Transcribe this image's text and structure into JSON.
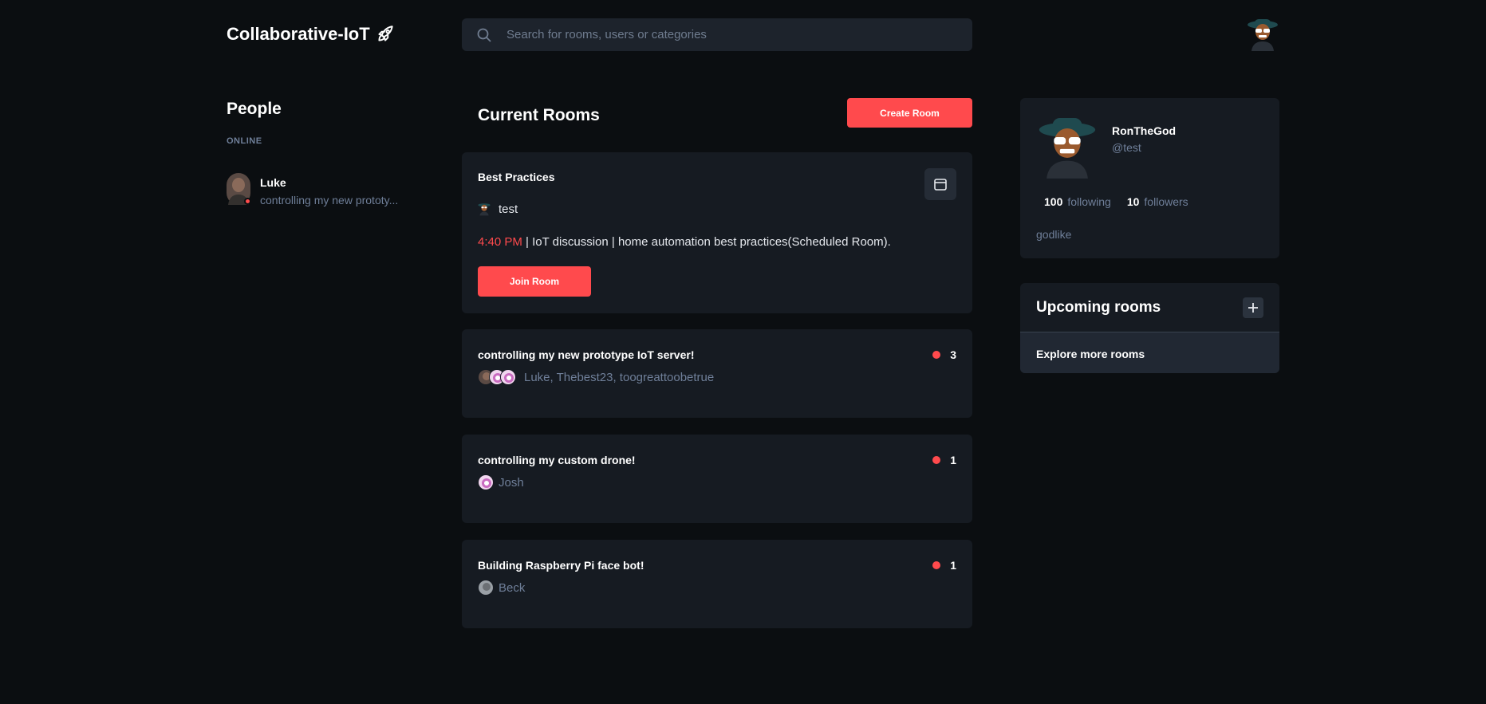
{
  "app": {
    "title": "Collaborative-IoT",
    "logo_icon": "rocket-icon"
  },
  "search": {
    "placeholder": "Search for rooms, users or categories"
  },
  "people": {
    "title": "People",
    "online_label": "ONLINE",
    "items": [
      {
        "name": "Luke",
        "status": "controlling my new prototy...",
        "online": true
      }
    ]
  },
  "rooms": {
    "title": "Current Rooms",
    "create_label": "Create Room",
    "scheduled": {
      "title": "Best Practices",
      "host": "test",
      "time": "4:40 PM",
      "description": " | IoT discussion | home automation best practices(Scheduled Room).",
      "join_label": "Join Room"
    },
    "list": [
      {
        "title": "controlling my new prototype IoT server!",
        "count": "3",
        "members": "Luke, Thebest23, toogreattoobetrue"
      },
      {
        "title": "controlling my custom drone!",
        "count": "1",
        "members": "Josh"
      },
      {
        "title": "Building Raspberry Pi face bot!",
        "count": "1",
        "members": "Beck"
      }
    ]
  },
  "profile": {
    "username": "RonTheGod",
    "handle": "@test",
    "following_count": "100",
    "following_label": "following",
    "followers_count": "10",
    "followers_label": "followers",
    "bio": "godlike"
  },
  "upcoming": {
    "title": "Upcoming rooms",
    "explore_label": "Explore more rooms"
  },
  "colors": {
    "accent": "#ff4a4d",
    "background": "#0b0e11",
    "card": "#161b22",
    "muted": "#6f7f99"
  }
}
